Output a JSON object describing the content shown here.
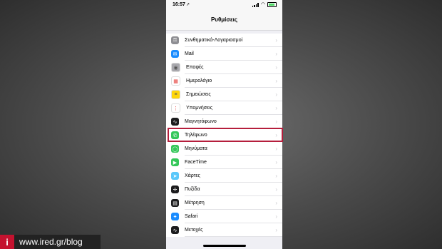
{
  "status": {
    "time": "16:57",
    "arrow": "↗"
  },
  "nav": {
    "title": "Ρυθμίσεις"
  },
  "rows": [
    {
      "label": "Συνθηματικά-Λογαριασμοί",
      "icon": "key-icon",
      "glyph": "⚿",
      "color": "#8e8e93"
    },
    {
      "label": "Mail",
      "icon": "mail-icon",
      "glyph": "✉",
      "color": "#1a8cff"
    },
    {
      "label": "Επαφές",
      "icon": "contacts-icon",
      "glyph": "◉",
      "color": "#a8a8ad"
    },
    {
      "label": "Ημερολόγιο",
      "icon": "calendar-icon",
      "glyph": "▦",
      "color": "#ffffff"
    },
    {
      "label": "Σημειώσεις",
      "icon": "notes-icon",
      "glyph": "≡",
      "color": "#ffd60a"
    },
    {
      "label": "Υπομνήσεις",
      "icon": "reminders-icon",
      "glyph": "⋮",
      "color": "#ffffff"
    },
    {
      "label": "Μαγνητόφωνο",
      "icon": "voice-memos-icon",
      "glyph": "∿",
      "color": "#1c1c1e"
    },
    {
      "label": "Τηλέφωνο",
      "icon": "phone-icon",
      "glyph": "✆",
      "color": "#34c759"
    },
    {
      "label": "Μηνύματα",
      "icon": "messages-icon",
      "glyph": "◯",
      "color": "#34c759"
    },
    {
      "label": "FaceTime",
      "icon": "facetime-icon",
      "glyph": "▶",
      "color": "#34c759"
    },
    {
      "label": "Χάρτες",
      "icon": "maps-icon",
      "glyph": "➤",
      "color": "#5ac8fa"
    },
    {
      "label": "Πυξίδα",
      "icon": "compass-icon",
      "glyph": "✛",
      "color": "#1c1c1e"
    },
    {
      "label": "Μέτρηση",
      "icon": "measure-icon",
      "glyph": "▤",
      "color": "#1c1c1e"
    },
    {
      "label": "Safari",
      "icon": "safari-icon",
      "glyph": "✦",
      "color": "#1a8cff"
    },
    {
      "label": "Μετοχές",
      "icon": "stocks-icon",
      "glyph": "∿",
      "color": "#1c1c1e"
    }
  ],
  "chevron": "›",
  "watermark": {
    "logo": "i",
    "text": "www.ired.gr/blog"
  }
}
